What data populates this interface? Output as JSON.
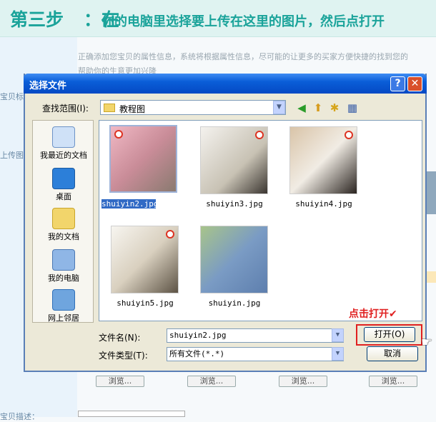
{
  "banner": {
    "step": "第三步",
    "colon": "：在",
    "text": "你的电脑里选择要上传在这里的图片，然后点打开"
  },
  "background": {
    "description_line1": "正确添加您宝贝的属性信息，系统将根据属性信息，尽可能的让更多的买家方便快捷的找到您的",
    "description_line2": "帮助你的生意更加兴隆",
    "left_label_1": "宝贝标",
    "left_label_2": "上传图",
    "left_label_3": "宝贝描述：",
    "browse_labels": [
      "浏览...",
      "浏览...",
      "浏览...",
      "浏览..."
    ]
  },
  "dialog": {
    "title": "选择文件",
    "help_label": "?",
    "close_label": "✕",
    "lookin_label": "查找范围(I):",
    "lookin_value": "教程图",
    "places": [
      {
        "label": "我最近的文档",
        "icon": "recent-documents-icon"
      },
      {
        "label": "桌面",
        "icon": "desktop-icon"
      },
      {
        "label": "我的文档",
        "icon": "my-documents-icon"
      },
      {
        "label": "我的电脑",
        "icon": "my-computer-icon"
      },
      {
        "label": "网上邻居",
        "icon": "network-places-icon"
      }
    ],
    "files": [
      {
        "name": "shuiyin2.jpg",
        "selected": true
      },
      {
        "name": "shuiyin3.jpg",
        "selected": false
      },
      {
        "name": "shuiyin4.jpg",
        "selected": false
      },
      {
        "name": "shuiyin5.jpg",
        "selected": false
      },
      {
        "name": "shuiyin.jpg",
        "selected": false
      }
    ],
    "filename_label": "文件名(N):",
    "filename_value": "shuiyin2.jpg",
    "filetype_label": "文件类型(T):",
    "filetype_value": "所有文件(*.*)",
    "open_button": "打开(O)",
    "cancel_button": "取消"
  },
  "annotation": {
    "text": "点击打开✔"
  },
  "colors": {
    "banner_text": "#1aa39a",
    "titlebar": "#0a5ed8",
    "annotation": "#e02020",
    "selection": "#316ac5"
  }
}
